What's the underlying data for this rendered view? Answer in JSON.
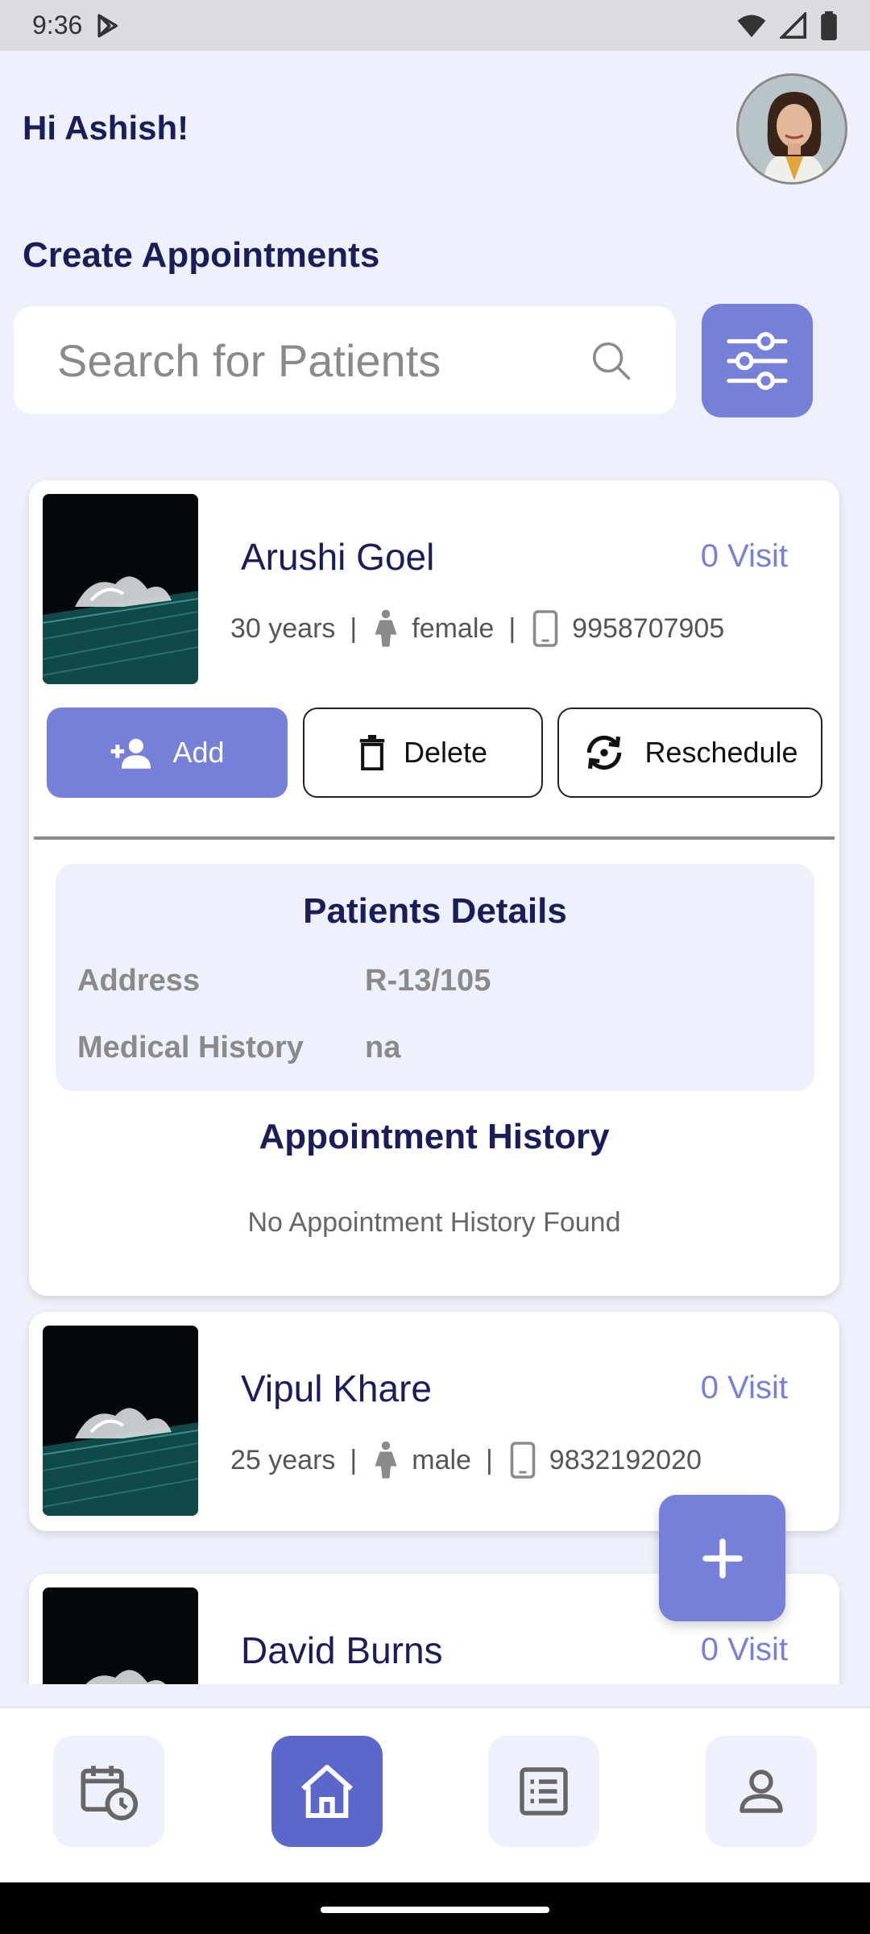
{
  "status_bar": {
    "time": "9:36"
  },
  "header": {
    "greeting": "Hi Ashish!"
  },
  "section_title": "Create Appointments",
  "search": {
    "placeholder": "Search for Patients"
  },
  "patients": [
    {
      "name": "Arushi  Goel",
      "visits": "0 Visit",
      "age": "30 years",
      "gender": "female",
      "phone": "9958707905",
      "actions": {
        "add": "Add",
        "delete": "Delete",
        "reschedule": "Reschedule"
      },
      "details": {
        "title": "Patients Details",
        "address_label": "Address",
        "address_value": "R-13/105",
        "history_label": "Medical History",
        "history_value": "na"
      },
      "appointment_history": {
        "title": "Appointment History",
        "empty": "No Appointment History Found"
      }
    },
    {
      "name": "Vipul  Khare",
      "visits": "0 Visit",
      "age": "25 years",
      "gender": "male",
      "phone": "9832192020"
    },
    {
      "name": "David  Burns",
      "visits": "0 Visit"
    }
  ],
  "bottom_nav": [
    "calendar-clock-icon",
    "home-icon",
    "list-icon",
    "profile-icon"
  ],
  "colors": {
    "accent": "#7680d8",
    "accent_dark": "#5c67cc",
    "title": "#1a1d5a",
    "background": "#eef0fb"
  }
}
